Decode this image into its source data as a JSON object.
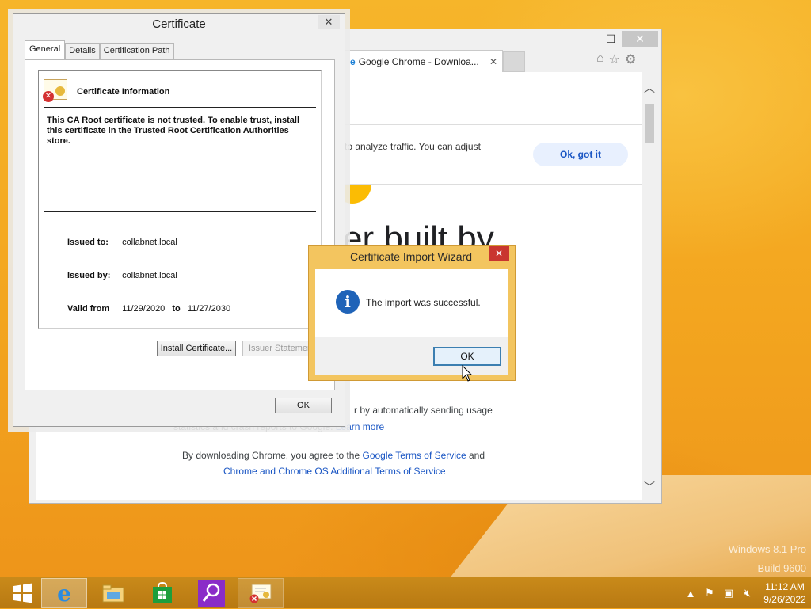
{
  "desktop": {
    "edition": "Windows 8.1 Pro",
    "build": "Build 9600"
  },
  "taskbar": {
    "items": [
      {
        "name": "start",
        "icon": "windows-logo-icon"
      },
      {
        "name": "internet-explorer",
        "icon": "internet-explorer-icon",
        "active": true
      },
      {
        "name": "file-explorer",
        "icon": "folder-icon"
      },
      {
        "name": "store",
        "icon": "store-bag-icon"
      },
      {
        "name": "search-app",
        "icon": "magnifier-icon"
      },
      {
        "name": "certificate",
        "icon": "certificate-icon",
        "open": true
      }
    ],
    "clock": {
      "time": "11:12 AM",
      "date": "9/26/2022"
    }
  },
  "browser": {
    "tab_title": "Google Chrome - Downloa...",
    "cookie_text": "to analyze traffic. You can adjust",
    "cookie_button": "Ok, got it",
    "hero": "er built by",
    "usage_text": "r by automatically sending usage",
    "crash_text": "statistics and crash reports to Google.",
    "learn_more": "Learn more",
    "terms_prefix": "By downloading Chrome, you agree to the",
    "terms_link": "Google Terms of Service",
    "terms_and": "and",
    "additional_terms": "Chrome and Chrome OS Additional Terms of Service"
  },
  "certificate": {
    "title": "Certificate",
    "close": "✕",
    "tabs": [
      "General",
      "Details",
      "Certification Path"
    ],
    "info_title": "Certificate Information",
    "warning": "This CA Root certificate is not trusted. To enable trust, install this certificate in the Trusted Root Certification Authorities store.",
    "issued_to_label": "Issued to:",
    "issued_to": "collabnet.local",
    "issued_by_label": "Issued by:",
    "issued_by": "collabnet.local",
    "valid_from_label": "Valid from",
    "valid_from": "11/29/2020",
    "valid_to_label": "to",
    "valid_to": "11/27/2030",
    "install_button": "Install Certificate...",
    "issuer_button": "Issuer Statement",
    "ok_button": "OK"
  },
  "wizard": {
    "title": "Certificate Import Wizard",
    "close": "✕",
    "message": "The import was successful.",
    "ok_button": "OK"
  }
}
